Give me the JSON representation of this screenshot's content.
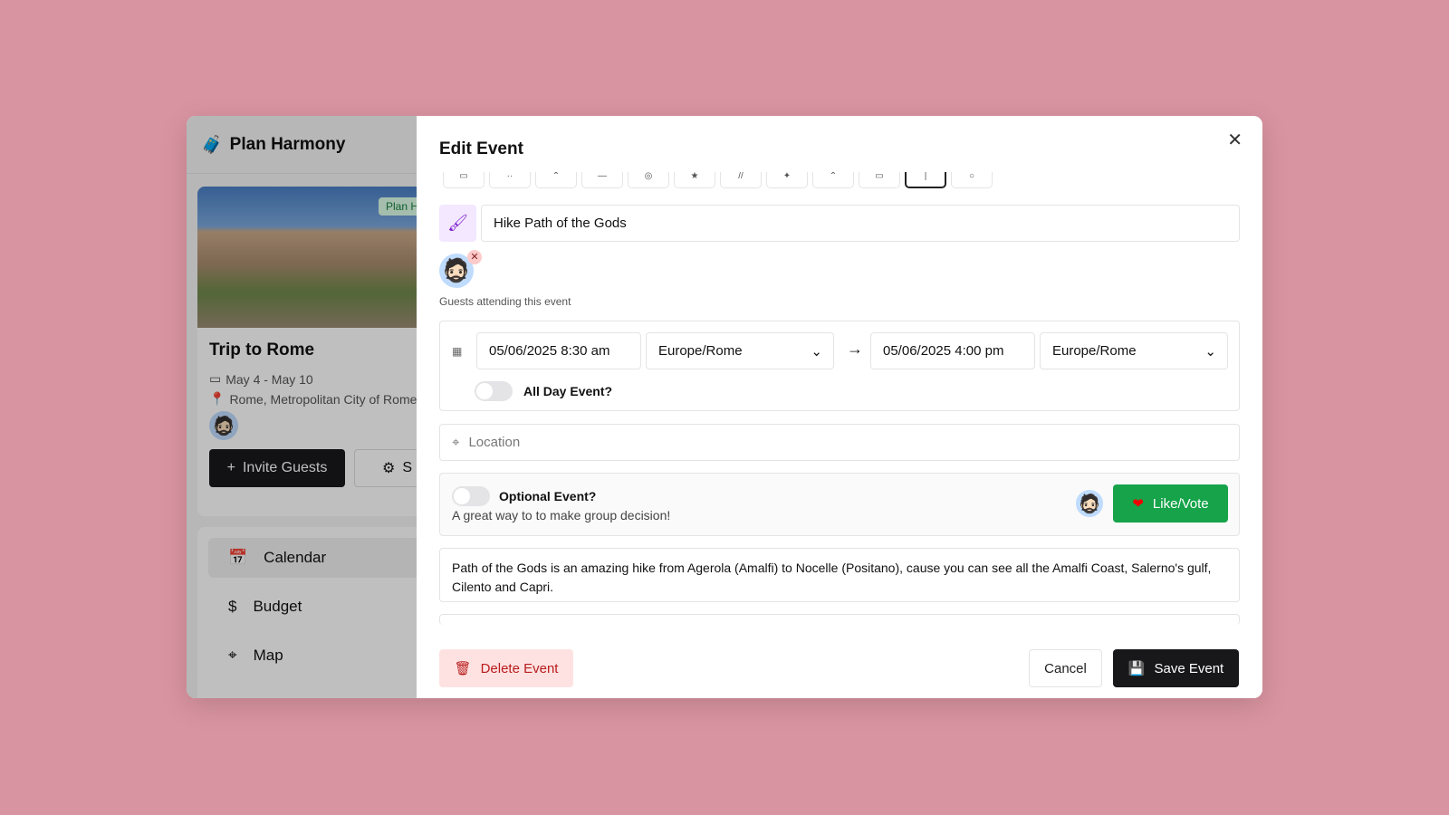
{
  "app": {
    "brand": "Plan Harmony"
  },
  "trip": {
    "badge": "Plan H",
    "name": "Trip to Rome",
    "dates": "May 4 - May 10",
    "location": "Rome, Metropolitan City of Rome",
    "invite_label": "Invite Guests",
    "settings_label": "S"
  },
  "nav": [
    {
      "label": "Calendar",
      "icon": "calendar-icon"
    },
    {
      "label": "Budget",
      "icon": "receipt-dollar-icon"
    },
    {
      "label": "Map",
      "icon": "map-pin-icon"
    }
  ],
  "dialog": {
    "title": "Edit Event",
    "event_title": "Hike Path of the Gods",
    "guests_label": "Guests attending this event",
    "start": "05/06/2025 8:30 am",
    "start_tz": "Europe/Rome",
    "end": "05/06/2025 4:00 pm",
    "end_tz": "Europe/Rome",
    "all_day_label": "All Day Event?",
    "all_day": false,
    "location_placeholder": "Location",
    "optional_label": "Optional Event?",
    "optional": false,
    "optional_hint": "A great way to to make group decision!",
    "like_label": "Like/Vote",
    "description": "Path of the Gods is an amazing hike from Agerola (Amalfi) to Nocelle (Positano), cause you can see all the Amalfi Coast, Salerno's gulf, Cilento and Capri.",
    "delete_label": "Delete Event",
    "cancel_label": "Cancel",
    "save_label": "Save Event"
  },
  "colors": {
    "background": "#d994a1",
    "like": "#16a34a",
    "delete_bg": "#fee2e2",
    "delete_text": "#b91c1c",
    "primary": "#18181b"
  }
}
